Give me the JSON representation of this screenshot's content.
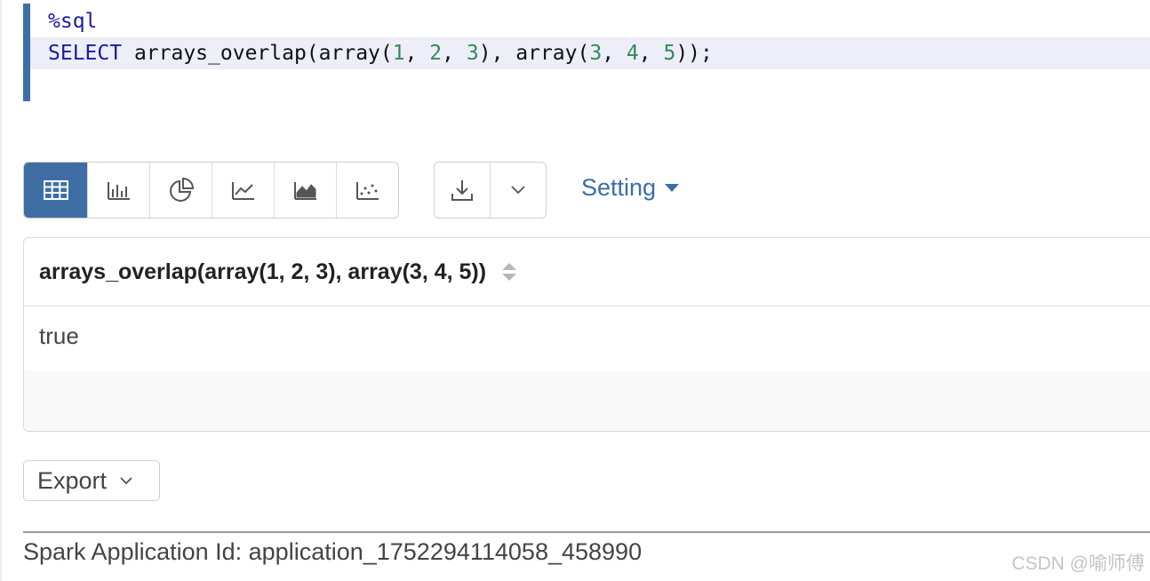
{
  "editor": {
    "line1": "%sql",
    "line2": {
      "keyword": "SELECT",
      "p1": " arrays_overlap(array(",
      "n1": "1",
      "s1": ", ",
      "n2": "2",
      "s2": ", ",
      "n3": "3",
      "p2": "), array(",
      "n4": "3",
      "s3": ", ",
      "n5": "4",
      "s4": ", ",
      "n6": "5",
      "p3": "));"
    }
  },
  "toolbar": {
    "viz_buttons": [
      "table-icon",
      "bar-chart-icon",
      "pie-chart-icon",
      "line-chart-icon",
      "area-chart-icon",
      "scatter-chart-icon"
    ],
    "download_buttons": [
      "download-icon",
      "chevron-down-icon"
    ],
    "setting_label": "Setting"
  },
  "table": {
    "column": "arrays_overlap(array(1, 2, 3), array(3, 4, 5))",
    "rows": [
      [
        "true"
      ]
    ]
  },
  "export": {
    "label": "Export"
  },
  "footer": {
    "app_id": "Spark Application Id: application_1752294114058_458990"
  },
  "watermark": "CSDN @喻师傅",
  "colors": {
    "accent": "#3f6ea5",
    "keyword": "#1a1aa6",
    "number": "#2e8b57",
    "active_line": "#eeeef9"
  }
}
